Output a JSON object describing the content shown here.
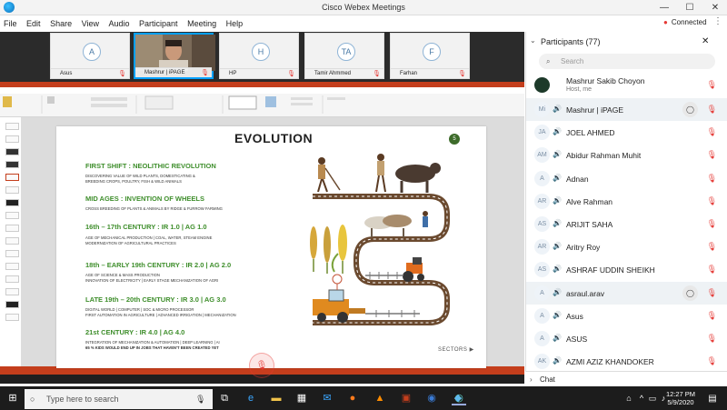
{
  "window": {
    "title": "Cisco Webex Meetings",
    "minimize": "—",
    "maximize": "☐",
    "close": "✕"
  },
  "menu": {
    "items": [
      "File",
      "Edit",
      "Share",
      "View",
      "Audio",
      "Participant",
      "Meeting",
      "Help"
    ]
  },
  "status": {
    "connected": "Connected"
  },
  "thumbnails": [
    {
      "initial": "A",
      "name": "Asus"
    },
    {
      "initial": "",
      "name": "Mashrur | iPAGE"
    },
    {
      "initial": "H",
      "name": "HP"
    },
    {
      "initial": "TA",
      "name": "Tamir Ahmmed"
    },
    {
      "initial": "F",
      "name": "Farhan"
    }
  ],
  "slide": {
    "title": "EVOLUTION",
    "number": "5",
    "footer": "SECTORS",
    "sections": [
      {
        "heading": "FIRST SHIFT : NEOLITHIC REVOLUTION",
        "lines": [
          "DISCOVERING VALUE OF WILD PLANTS, DOMESTICATING &",
          "BREEDING CROPS, POULTRY, FISH & WILD ANIMALS"
        ]
      },
      {
        "heading": "MID AGES : INVENTION OF WHEELS",
        "lines": [
          "CROSS BREEDING OF PLANTS & ANIMALS BY RIDGE & FURROW FARMING"
        ]
      },
      {
        "heading": "16th – 17th CENTURY : IR 1.0 | AG 1.0",
        "lines": [
          "AGE OF MECHANICAL PRODUCTION | COAL, WATER, STEAM ENGINE",
          "MODERNIZATION OF AGRICULTURAL PRACTICES"
        ]
      },
      {
        "heading": "18th – EARLY 19th CENTURY : IR 2.0 | AG 2.0",
        "lines": [
          "AGE OF SCIENCE & MASS PRODUCTION",
          "INNOVATION OF ELECTRICITY | EARLY STAGE MECHANIZATION OF AGRI"
        ]
      },
      {
        "heading": "LATE 19th – 20th CENTURY : IR 3.0 | AG 3.0",
        "lines": [
          "DIGITAL WORLD | COMPUTER | SOC & MICRO PROCESSOR",
          "FIRST AUTOMATION IN AGRICULTURE | ADVANCED IRRIGATION | MECHANIZATION"
        ]
      },
      {
        "heading": "21st CENTURY : IR 4.0 | AG 4.0",
        "lines": [
          "INTEGRATION OF MECHANIZATION & AUTOMATION | DEEP LEARNING | AI",
          "65 % KIDS WOULD END UP IN JOBS THAT HAVEN'T BEEN CREATED YET"
        ]
      }
    ]
  },
  "participants": {
    "header": "Participants (77)",
    "search_placeholder": "Search",
    "host": {
      "name": "Mashrur Sakib Choyon",
      "role": "Host, me"
    },
    "list": [
      {
        "initials": "Mi",
        "name": "Mashrur | iPAGE",
        "highlight": true,
        "chat": true
      },
      {
        "initials": "JA",
        "name": "JOEL AHMED",
        "highlight": false,
        "chat": false
      },
      {
        "initials": "AM",
        "name": "Abidur Rahman Muhit",
        "highlight": false,
        "chat": false
      },
      {
        "initials": "A",
        "name": "Adnan",
        "highlight": false,
        "chat": false
      },
      {
        "initials": "AR",
        "name": "Alve Rahman",
        "highlight": false,
        "chat": false
      },
      {
        "initials": "AS",
        "name": "ARIJIT SAHA",
        "highlight": false,
        "chat": false
      },
      {
        "initials": "AR",
        "name": "Aritry Roy",
        "highlight": false,
        "chat": false
      },
      {
        "initials": "AS",
        "name": "ASHRAF UDDIN SHEIKH",
        "highlight": false,
        "chat": false
      },
      {
        "initials": "A",
        "name": "asraul.arav",
        "highlight": true,
        "chat": true
      },
      {
        "initials": "A",
        "name": "Asus",
        "highlight": false,
        "chat": false
      },
      {
        "initials": "A",
        "name": "ASUS",
        "highlight": false,
        "chat": false
      },
      {
        "initials": "AK",
        "name": "AZMI AZIZ KHANDOKER",
        "highlight": false,
        "chat": false
      }
    ],
    "chat_label": "Chat"
  },
  "taskbar": {
    "search_placeholder": "Type here to search",
    "time": "12:27 PM",
    "date": "5/9/2020"
  },
  "colors": {
    "accent_red": "#e53935",
    "ppt_red": "#c43e1c",
    "slide_green": "#3e8e2b",
    "webex_blue": "#00a0ff"
  }
}
